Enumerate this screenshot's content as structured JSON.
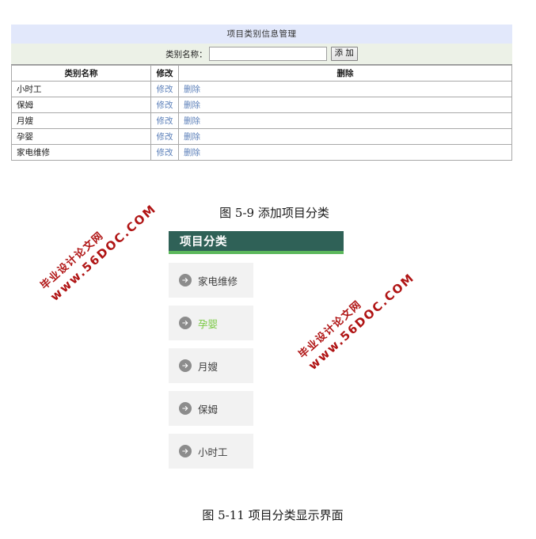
{
  "admin_panel": {
    "title": "项目类别信息管理",
    "form": {
      "label": "类别名称：",
      "input_value": "",
      "input_placeholder": "",
      "add_button": "添 加"
    },
    "table": {
      "headers": [
        "类别名称",
        "修改",
        "删除"
      ],
      "rows": [
        {
          "name": "小时工",
          "edit": "修改",
          "delete": "删除"
        },
        {
          "name": "保姆",
          "edit": "修改",
          "delete": "删除"
        },
        {
          "name": "月嫂",
          "edit": "修改",
          "delete": "删除"
        },
        {
          "name": "孕婴",
          "edit": "修改",
          "delete": "删除"
        },
        {
          "name": "家电维修",
          "edit": "修改",
          "delete": "删除"
        }
      ]
    }
  },
  "captions": {
    "figure_1": "图 5-9 添加项目分类",
    "figure_2": "图 5-11 项目分类显示界面"
  },
  "frontend_panel": {
    "header_title": "项目分类",
    "items": [
      {
        "label": "家电维修",
        "active": false,
        "icon": "arrow-right-circle-icon"
      },
      {
        "label": "孕婴",
        "active": true,
        "icon": "arrow-right-circle-icon"
      },
      {
        "label": "月嫂",
        "active": false,
        "icon": "arrow-right-circle-icon"
      },
      {
        "label": "保姆",
        "active": false,
        "icon": "arrow-right-circle-icon"
      },
      {
        "label": "小时工",
        "active": false,
        "icon": "arrow-right-circle-icon"
      }
    ]
  },
  "watermarks": [
    {
      "line1": "毕业设计论文网",
      "line2": "www.56DOC.COM"
    },
    {
      "line1": "毕业设计论文网",
      "line2": "www.56DOC.COM"
    }
  ],
  "colors": {
    "title_bar": "#e2e8fb",
    "form_row": "#ecf1e7",
    "panel_header": "#2f6157",
    "panel_accent": "#5cb85c",
    "active_item": "#7ac943",
    "link": "#5b7fb9",
    "watermark": "#b01414"
  }
}
